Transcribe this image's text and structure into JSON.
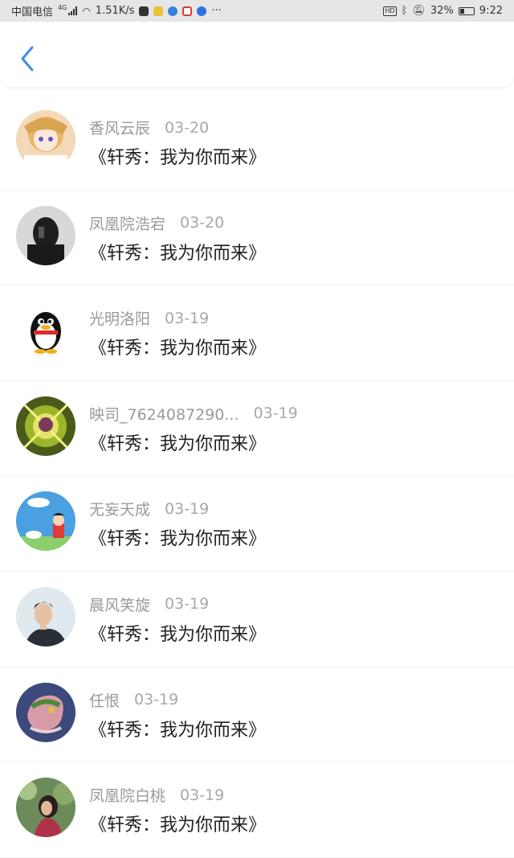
{
  "status_bar": {
    "carrier": "中国电信",
    "network": "4G",
    "speed": "1.51K/s",
    "more": "···",
    "hd": "HD",
    "battery": "32%",
    "time": "9:22"
  },
  "header": {
    "back_icon": "chevron-left-icon",
    "accent_color": "#3d8ee0"
  },
  "comments": [
    {
      "user": "香风云辰",
      "date": "03-20",
      "text": "《轩秀：我为你而来》",
      "avatar": "anime-girl-avatar"
    },
    {
      "user": "凤凰院浩宕",
      "date": "03-20",
      "text": "《轩秀：我为你而来》",
      "avatar": "dark-figure-avatar"
    },
    {
      "user": "光明洛阳",
      "date": "03-19",
      "text": "《轩秀：我为你而来》",
      "avatar": "qq-penguin-avatar"
    },
    {
      "user": "映司_7624087290...",
      "date": "03-19",
      "text": "《轩秀：我为你而来》",
      "avatar": "glowing-emblem-avatar"
    },
    {
      "user": "无妄天成",
      "date": "03-19",
      "text": "《轩秀：我为你而来》",
      "avatar": "cartoon-sky-avatar"
    },
    {
      "user": "晨风笑旋",
      "date": "03-19",
      "text": "《轩秀：我为你而来》",
      "avatar": "man-portrait-avatar"
    },
    {
      "user": "任恨",
      "date": "03-19",
      "text": "《轩秀：我为你而来》",
      "avatar": "dragon-illustration-avatar"
    },
    {
      "user": "凤凰院白桃",
      "date": "03-19",
      "text": "《轩秀：我为你而来》",
      "avatar": "girl-photo-avatar"
    }
  ]
}
